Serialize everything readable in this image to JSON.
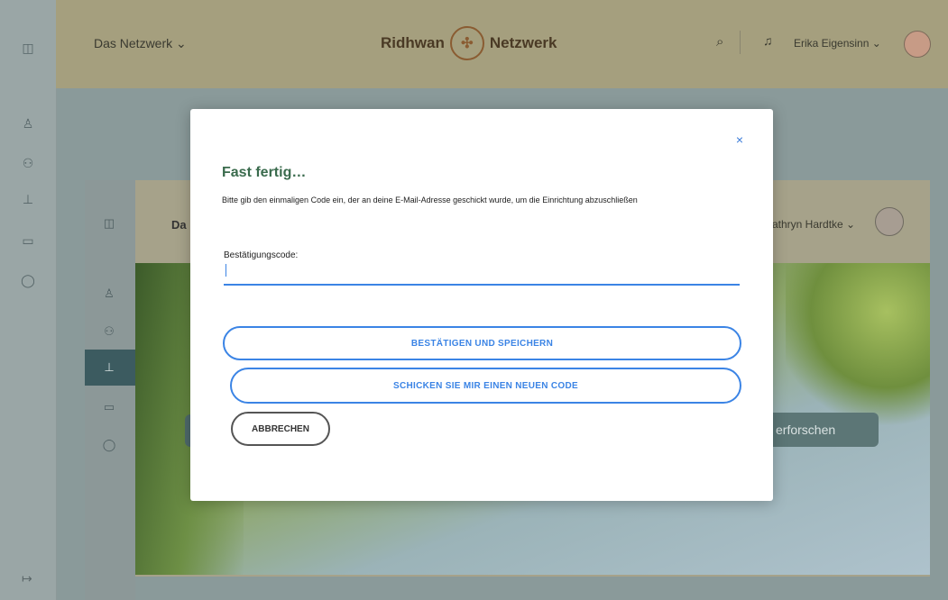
{
  "app": {
    "network_menu": "Das Netzwerk ⌄",
    "brand_left": "Ridhwan",
    "brand_right": "Netzwerk",
    "user_menu": "Erika Eigensinn ⌄"
  },
  "inner_app": {
    "header_left": "Da",
    "header_user": "athryn Hardtke ⌄",
    "explore_button": "erforschen"
  },
  "icons": {
    "sidebar_toggle": "sidebar-toggle-icon",
    "people": "people-icon",
    "groups": "groups-icon",
    "pin": "pin-icon",
    "chat": "chat-icon",
    "shield": "shield-icon",
    "logout": "logout-icon",
    "search": "search-icon",
    "bell": "bell-icon",
    "close": "close-icon"
  },
  "colors": {
    "accent_blue": "#3b84e5",
    "title_green": "#3a6b4d"
  },
  "modal": {
    "close_label": "×",
    "title": "Fast fertig…",
    "description": "Bitte gib den einmaligen Code ein, der an deine E-Mail-Adresse geschickt wurde, um die Einrichtung abzuschließen",
    "field_label": "Bestätigungscode:",
    "code_value": "",
    "confirm_button": "BESTÄTIGEN UND SPEICHERN",
    "resend_button": "SCHICKEN SIE MIR EINEN NEUEN CODE",
    "cancel_button": "ABBRECHEN"
  }
}
